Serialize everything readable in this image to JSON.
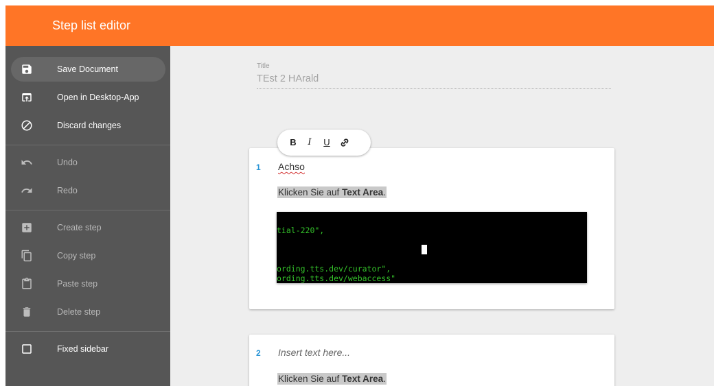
{
  "header": {
    "title": "Step list editor",
    "accent_color": "#ff7526"
  },
  "sidebar": {
    "items": [
      {
        "label": "Save Document",
        "icon": "save-icon",
        "enabled": true,
        "selected": true
      },
      {
        "label": "Open in Desktop-App",
        "icon": "open-in-app-icon",
        "enabled": true
      },
      {
        "label": "Discard changes",
        "icon": "block-icon",
        "enabled": true
      },
      {
        "label": "Undo",
        "icon": "undo-icon",
        "enabled": false
      },
      {
        "label": "Redo",
        "icon": "redo-icon",
        "enabled": false
      },
      {
        "label": "Create step",
        "icon": "add-box-icon",
        "enabled": false
      },
      {
        "label": "Copy step",
        "icon": "copy-icon",
        "enabled": false
      },
      {
        "label": "Paste step",
        "icon": "clipboard-icon",
        "enabled": false
      },
      {
        "label": "Delete step",
        "icon": "trash-icon",
        "enabled": false
      },
      {
        "label": "Fixed sidebar",
        "icon": "checkbox-unchecked-icon",
        "enabled": true,
        "checked": false
      }
    ]
  },
  "document": {
    "title_label": "Title",
    "title_value": "TEst 2 HArald",
    "format_toolbar": {
      "bold": "B",
      "italic": "I",
      "underline": "U",
      "link_icon": "link-icon"
    },
    "steps": [
      {
        "number": "1",
        "text": "Achso",
        "instruction_prefix": "Klicken Sie auf ",
        "instruction_target": "Text Area",
        "instruction_suffix": ".",
        "screenshot_lines": [
          "tial-220\",",
          "ording.tts.dev/curator\",",
          "ording.tts.dev/webaccess\""
        ]
      },
      {
        "number": "2",
        "placeholder": "Insert text here...",
        "instruction_prefix": "Klicken Sie auf ",
        "instruction_target": "Text Area",
        "instruction_suffix": "."
      }
    ]
  }
}
